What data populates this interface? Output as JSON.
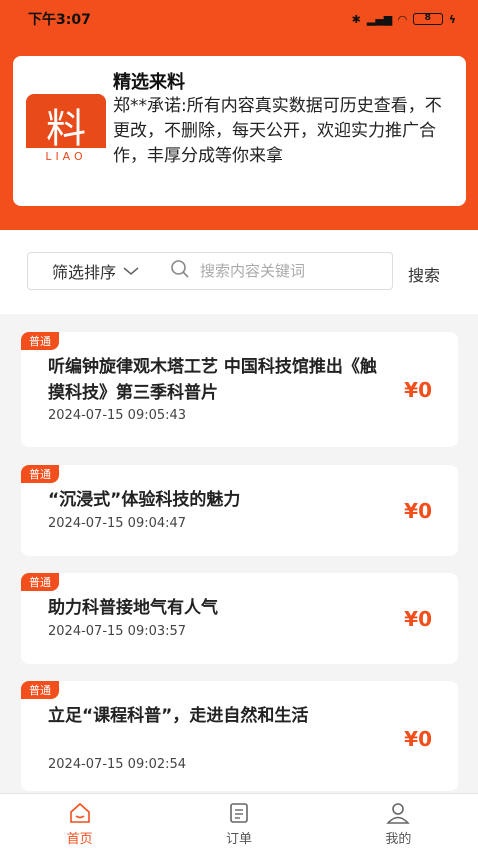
{
  "status_bar": {
    "time": "下午3:07",
    "battery": "8"
  },
  "banner": {
    "logo_char": "料",
    "logo_sub": "LIAO",
    "title": "精选来料",
    "text": "郑**承诺:所有内容真实数据可历史查看，不更改，不删除，每天公开，欢迎实力推广合作，丰厚分成等你来拿"
  },
  "search": {
    "filter_label": "筛选排序",
    "placeholder": "搜索内容关键词",
    "button_label": "搜索"
  },
  "items": [
    {
      "tag": "普通",
      "title": "听编钟旋律观木塔工艺 中国科技馆推出《触摸科技》第三季科普片",
      "date": "2024-07-15 09:05:43",
      "price": "¥0"
    },
    {
      "tag": "普通",
      "title": "“沉浸式”体验科技的魅力",
      "date": "2024-07-15 09:04:47",
      "price": "¥0"
    },
    {
      "tag": "普通",
      "title": "助力科普接地气有人气",
      "date": "2024-07-15 09:03:57",
      "price": "¥0"
    },
    {
      "tag": "普通",
      "title": "立足“课程科普”，走进自然和生活",
      "date": "2024-07-15 09:02:54",
      "price": "¥0"
    }
  ],
  "tabbar": {
    "home": "首页",
    "orders": "订单",
    "mine": "我的"
  },
  "colors": {
    "accent": "#f24f1c"
  }
}
